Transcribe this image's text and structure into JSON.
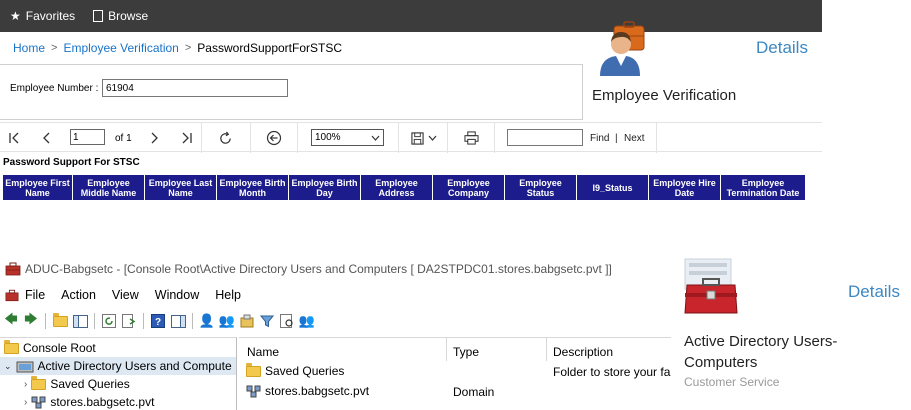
{
  "topbar": {
    "favorites": "Favorites",
    "browse": "Browse"
  },
  "breadcrumb": {
    "home": "Home",
    "section": "Employee Verification",
    "current": "PasswordSupportForSTSC",
    "separator": ">"
  },
  "parameters": {
    "employee_number_label": "Employee Number :",
    "employee_number_value": "61904"
  },
  "toolbar": {
    "page_value": "1",
    "page_of": "of 1",
    "zoom": "100%",
    "find": "Find",
    "find_divider": "|",
    "next": "Next"
  },
  "report": {
    "title": "Password Support For STSC",
    "columns": [
      "Employee First Name",
      "Employee Middle Name",
      "Employee Last Name",
      "Employee Birth Month",
      "Employee Birth Day",
      "Employee Address",
      "Employee Company",
      "Employee Status",
      "I9_Status",
      "Employee Hire Date",
      "Employee Termination Date"
    ],
    "header_color": "#1c1c8c"
  },
  "tile_employee": {
    "details": "Details",
    "name": "Employee Verification"
  },
  "aduc": {
    "title": "ADUC-Babgsetc - [Console Root\\Active Directory Users and Computers [ DA2STPDC01.stores.babgsetc.pvt ]]",
    "menu": [
      "File",
      "Action",
      "View",
      "Window",
      "Help"
    ],
    "tree": {
      "root": "Console Root",
      "aduc_node": "Active Directory Users and Compute",
      "saved_queries": "Saved Queries",
      "domain": "stores.babgsetc.pvt"
    },
    "list": {
      "headers": [
        "Name",
        "Type",
        "Description"
      ],
      "rows": [
        {
          "name": "Saved Queries",
          "type": "",
          "description": "Folder to store your fa"
        },
        {
          "name": "stores.babgsetc.pvt",
          "type": "Domain",
          "description": ""
        }
      ]
    }
  },
  "tile_ad": {
    "details": "Details",
    "name": "Active Directory Users-Computers",
    "category": "Customer Service"
  },
  "colors": {
    "accent_blue": "#3c88c2",
    "link_blue": "#1a73c8",
    "topbar": "#3c3c3c"
  }
}
